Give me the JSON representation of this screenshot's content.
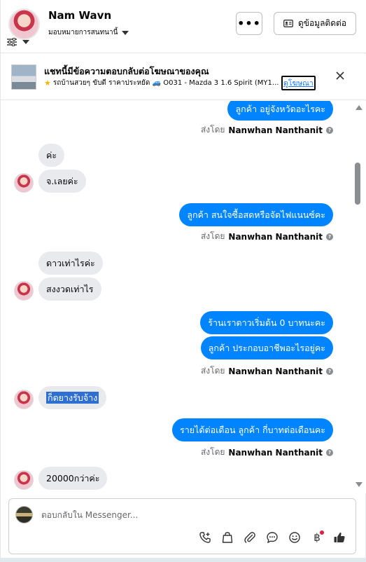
{
  "header": {
    "name": "Nam Wavn",
    "assign_label": "มอบหมายการสนทนานี้",
    "more_label": "•••",
    "contact_button": "ดูข้อมูลติดต่อ"
  },
  "ad_banner": {
    "title": "แชทนี้มีข้อความตอบกลับต่อโฆษณาของคุณ",
    "subtitle": "รถบ้านสวยๆ ขับดี ราคาประหยัด 🚙 O031 - Mazda 3 1.6 Spirit (MY1...",
    "link_label": "ดูโฆษณา"
  },
  "messages": {
    "m1": {
      "text": "ลูกค้า อยู่จังหวัดอะไรคะ"
    },
    "sent1": {
      "prefix": "ส่งโดย",
      "sender": "Nanwhan Nanthanit"
    },
    "m2": {
      "text": "ค่ะ"
    },
    "m3": {
      "text": "จ.เลยค่ะ"
    },
    "m4": {
      "text": "ลูกค้า สนใจซื้อสดหรือจัดไฟแนนซ์คะ"
    },
    "sent2": {
      "prefix": "ส่งโดย",
      "sender": "Nanwhan Nanthanit"
    },
    "m5": {
      "text": "ดาวเท่าไรค่ะ"
    },
    "m6": {
      "text": "สงงวดเท่าไร"
    },
    "m7": {
      "text": "ร้านเราดาวเริ่มต้น 0 บาทนะคะ"
    },
    "m8": {
      "text": "ลูกค้า ประกอบอาชีพอะไรอยู่คะ"
    },
    "sent3": {
      "prefix": "ส่งโดย",
      "sender": "Nanwhan Nanthanit"
    },
    "m9": {
      "text": "ก็ดยางรับจ้าง"
    },
    "m10": {
      "text": "รายได้ต่อเดือน  ลูกค้า กี่บาทต่อเดือนคะ"
    },
    "sent4": {
      "prefix": "ส่งโดย",
      "sender": "Nanwhan Nanthanit"
    },
    "m11": {
      "text": "20000กว่าค่ะ"
    }
  },
  "composer": {
    "placeholder": "ตอบกลับใน Messenger..."
  },
  "icons": {
    "help": "?",
    "baht": "฿"
  },
  "colors": {
    "outgoing": "#0084ff",
    "incoming": "#e9eaed",
    "highlight": "#2d6fd3",
    "link": "#1877f2"
  }
}
